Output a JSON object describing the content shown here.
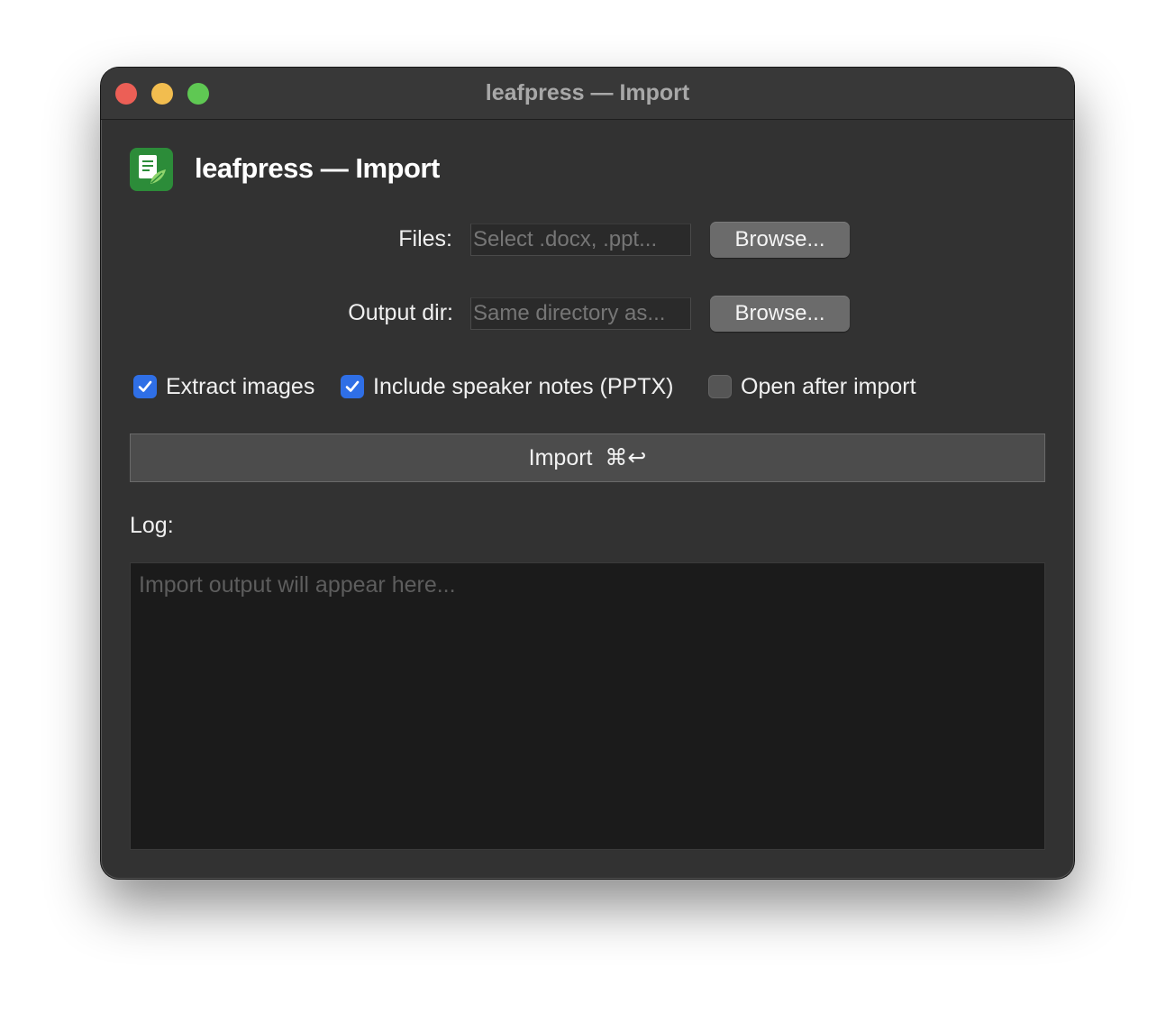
{
  "window": {
    "title": "leafpress — Import"
  },
  "header": {
    "title": "leafpress — Import",
    "icon": "document-leaf-icon"
  },
  "files": {
    "label": "Files:",
    "placeholder": "Select .docx, .ppt...",
    "browse_label": "Browse..."
  },
  "output": {
    "label": "Output dir:",
    "placeholder": "Same directory as...",
    "browse_label": "Browse..."
  },
  "options": {
    "extract_images": {
      "label": "Extract images",
      "checked": true
    },
    "speaker_notes": {
      "label": "Include speaker notes (PPTX)",
      "checked": true
    },
    "open_after": {
      "label": "Open after import",
      "checked": false
    }
  },
  "import_button": {
    "label": "Import",
    "shortcut": "⌘↩"
  },
  "log": {
    "label": "Log:",
    "placeholder": "Import output will appear here..."
  },
  "colors": {
    "window_bg": "#323232",
    "accent": "#2f6fe6",
    "app_icon": "#2c8c39",
    "close": "#ec5f56",
    "minimize": "#f2bd4f",
    "maximize": "#5fc853"
  }
}
